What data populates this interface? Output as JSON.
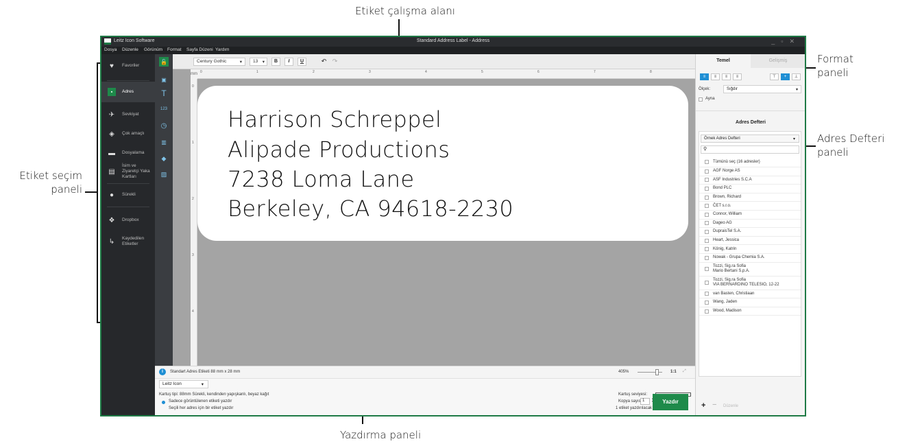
{
  "annotations": {
    "workspace": "Etiket çalışma alanı",
    "format_panel": [
      "Format",
      "paneli"
    ],
    "address_book_panel": [
      "Adres Defteri",
      "paneli"
    ],
    "label_selection_panel": [
      "Etiket seçim",
      "paneli"
    ],
    "print_panel": "Yazdırma paneli"
  },
  "window": {
    "app_name": "Leitz Icon Software",
    "document_title": "Standard Address Label - Address",
    "menu": [
      "Dosya",
      "Düzenle",
      "Görünüm",
      "Format",
      "Sayfa Düzeni",
      "Yardım"
    ]
  },
  "sidebar": {
    "items": [
      {
        "label": "Favoriler",
        "icon": "heart-icon"
      },
      {
        "label": "Adres",
        "icon": "address-icon"
      },
      {
        "label": "Sevkiyat",
        "icon": "shipping-icon"
      },
      {
        "label": "Çok amaçlı",
        "icon": "layers-icon"
      },
      {
        "label": "Dosyalama",
        "icon": "folder-icon"
      },
      {
        "label": "İsim ve Ziyaretçi Yaka Kartları",
        "icon": "badge-icon"
      },
      {
        "label": "Sürekli",
        "icon": "tape-icon"
      },
      {
        "label": "Dropbox",
        "icon": "dropbox-icon"
      },
      {
        "label": "Kaydedilen Etiketler",
        "icon": "saved-icon"
      }
    ]
  },
  "toolbar": {
    "font": "Century Gothic",
    "size": "13",
    "bold": "B",
    "italic": "I",
    "underline": "U"
  },
  "canvas": {
    "ruler_unit": "mm",
    "h_ticks": [
      "0",
      "1",
      "2",
      "3",
      "4",
      "5",
      "6",
      "7",
      "8"
    ],
    "v_ticks": [
      "0",
      "1",
      "2",
      "3",
      "4"
    ],
    "label_lines": [
      "Harrison Schreppel",
      "Alipade Productions",
      "7238 Loma Lane",
      "Berkeley, CA 94618-2230"
    ]
  },
  "status": {
    "label_name": "Standart Adres Etiketi 88 mm x 28 mm",
    "zoom": "405%",
    "ratio": "1:1"
  },
  "print": {
    "printer": "Leitz Icon",
    "cartridge": "Kartuş tipi: 88mm Sürekli, kendinden yapışkanlı, beyaz kağıt",
    "cartridge_level": "Kartuş seviyesi:",
    "option1": "Sadece görüntülenen etiketi yazdır",
    "option2": "Seçili her adres için bir etiket yazdır",
    "copies_label": "Kopya sayısı:",
    "copies": "1",
    "count_text": "1 etiket yazdırılacak",
    "print_button": "Yazdır"
  },
  "right_panel": {
    "tabs": [
      "Temel",
      "Gelişmiş"
    ],
    "scale_label": "Ölçek:",
    "scale_value": "Sığdır",
    "mirror": "Ayna",
    "address_book_title": "Adres Defteri",
    "book_select": "Örnek Adres Defteri",
    "select_all": "Tümünü seç (16 adresler)",
    "entries": [
      "AGF Norge AS",
      "ASF Industries S.C.A",
      "Bond PLC",
      "Brown, Richard",
      "ČET s.r.o.",
      "Connor, William",
      "Dageo AG",
      "DupraisTel S.A.",
      "Heart, Jessica",
      "König, Katrin",
      "Nowak - Grupa Chemia S.A.",
      [
        "Tozzi, Sig.ra Sofia",
        "Mario Bertani S.p.A."
      ],
      [
        "Tozzi, Sig.ra Sofia",
        "VIA BERNARDINO TELESIO, 12-22"
      ],
      "van Basten, Christiaan",
      "Wang, Jaden",
      "Wood, Madison"
    ],
    "edit_label": "Düzenle"
  }
}
